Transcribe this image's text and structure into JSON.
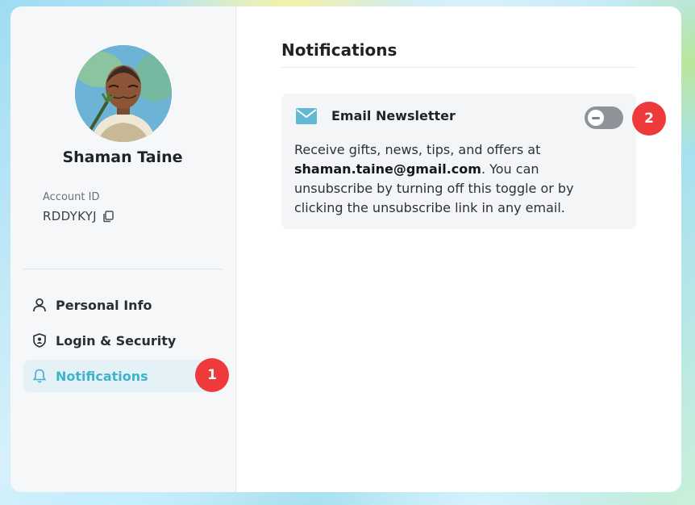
{
  "profile": {
    "name": "Shaman Taine",
    "account_id_label": "Account ID",
    "account_id": "RDDYKYJ"
  },
  "sidebar": {
    "items": [
      {
        "label": "Personal Info",
        "icon": "user-icon",
        "active": false
      },
      {
        "label": "Login & Security",
        "icon": "shield-icon",
        "active": false
      },
      {
        "label": "Notifications",
        "icon": "bell-icon",
        "active": true
      }
    ],
    "badge": "1"
  },
  "main": {
    "title": "Notifications",
    "email_newsletter": {
      "icon": "mail-icon",
      "title": "Email Newsletter",
      "toggle_on": false,
      "badge": "2",
      "desc_before": "Receive gifts, news, tips, and offers at ",
      "email": "shaman.taine@gmail.com",
      "desc_after": ". You can unsubscribe by turning off this toggle or by clicking the unsubscribe link in any email."
    }
  },
  "colors": {
    "accent": "#3fb2cc",
    "badge": "#ee3a3a",
    "toggle_off": "#8e9399"
  }
}
